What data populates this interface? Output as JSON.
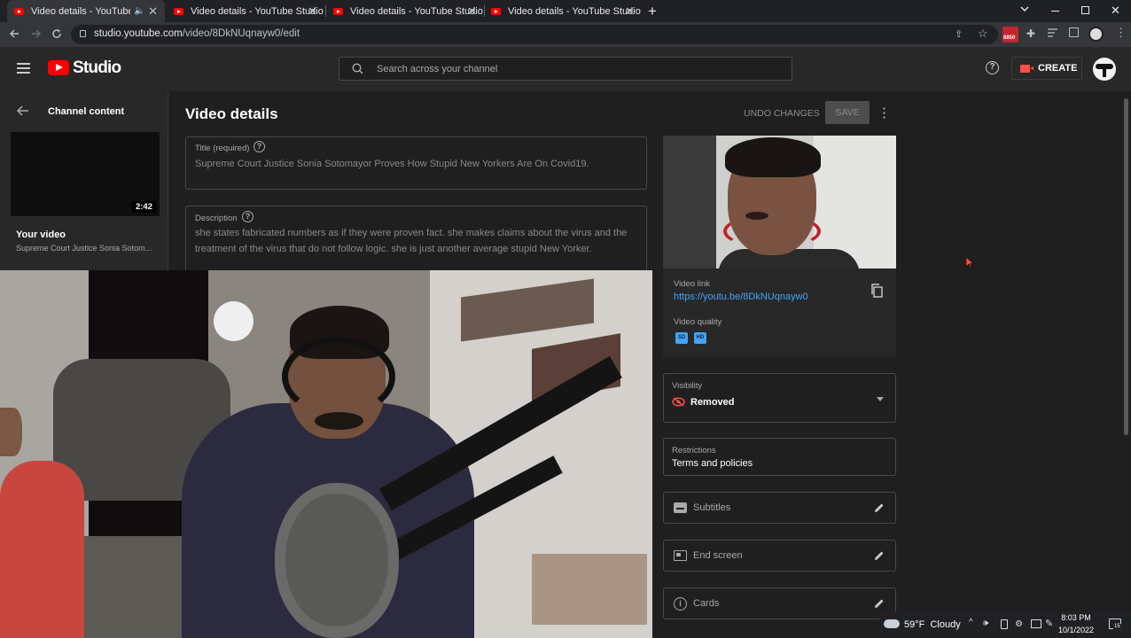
{
  "browser": {
    "tabs": [
      {
        "title": "Video details - YouTube Studio",
        "active": true,
        "audio": true
      },
      {
        "title": "Video details - YouTube Studio",
        "active": false
      },
      {
        "title": "Video details - YouTube Studio",
        "active": false
      },
      {
        "title": "Video details - YouTube Studio",
        "active": false
      }
    ],
    "url_host": "studio.youtube.com",
    "url_path": "/video/8DkNUqnayw0/edit",
    "ext_badge": "8850"
  },
  "header": {
    "logo_text": "Studio",
    "search_placeholder": "Search across your channel",
    "create_label": "CREATE"
  },
  "sidebar": {
    "back_label": "Channel content",
    "thumb_duration": "2:42",
    "your_video_label": "Your video",
    "video_title_short": "Supreme Court Justice Sonia Sotom..."
  },
  "main": {
    "page_title": "Video details",
    "undo_label": "UNDO CHANGES",
    "save_label": "SAVE",
    "title_field": {
      "label": "Title (required)",
      "value": "Supreme Court Justice Sonia Sotomayor Proves How Stupid New Yorkers Are On Covid19."
    },
    "description_field": {
      "label": "Description",
      "line1": "she states fabricated numbers as if they were proven fact. she makes claims about the virus and the",
      "line2": "treatment of the virus that do not follow logic. she is just another average stupid New Yorker."
    }
  },
  "right_panel": {
    "video_link_label": "Video link",
    "video_link": "https://youtu.be/8DkNUqnayw0",
    "video_quality_label": "Video quality",
    "quality_badges": [
      "SD",
      "HD"
    ],
    "visibility_label": "Visibility",
    "visibility_value": "Removed",
    "restrictions_label": "Restrictions",
    "restrictions_value": "Terms and policies",
    "rows": [
      {
        "icon": "subtitles-icon",
        "label": "Subtitles"
      },
      {
        "icon": "end-screen-icon",
        "label": "End screen"
      },
      {
        "icon": "info-icon",
        "label": "Cards"
      }
    ]
  },
  "taskbar": {
    "weather": "59°F  Cloudy",
    "time": "8:03 PM",
    "date": "10/1/2022",
    "notif_count": "15"
  },
  "colors": {
    "accent_blue": "#3ea6ff",
    "brand_red": "#ff0000",
    "removed_red": "#ff4e45",
    "quality_blue": "#3ea6ff"
  }
}
